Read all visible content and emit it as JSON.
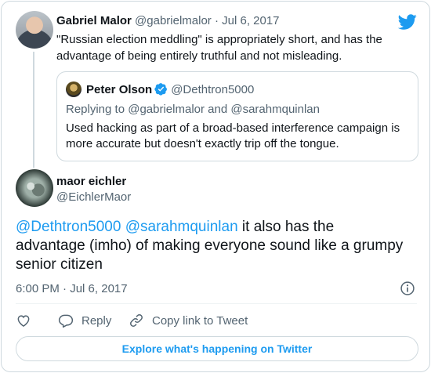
{
  "parent_tweet": {
    "name": "Gabriel Malor",
    "handle": "@gabrielmalor",
    "separator": " · ",
    "date": "Jul 6, 2017",
    "text": "\"Russian election meddling\" is appropriately short, and has the advantage of being entirely truthful and not misleading."
  },
  "quoted_tweet": {
    "name": "Peter Olson",
    "handle": "@Dethtron5000",
    "reply_prefix": "Replying to ",
    "reply_user_1": "@gabrielmalor",
    "reply_and": " and ",
    "reply_user_2": "@sarahmquinlan",
    "text": "Used hacking as part of a broad-based interference campaign is more accurate but doesn't exactly trip off the tongue."
  },
  "main_tweet": {
    "name": "maor eichler",
    "handle": "@EichlerMaor",
    "mention_1": "@Dethtron5000",
    "mention_2": "@sarahmquinlan",
    "text_rest": " it also has the advantage (imho) of making everyone sound like a grumpy senior citizen",
    "time": "6:00 PM",
    "date_sep": " · ",
    "date": "Jul 6, 2017"
  },
  "actions": {
    "reply_label": "Reply",
    "copy_link_label": "Copy link to Tweet"
  },
  "explore_label": "Explore what's happening on Twitter",
  "icons": {
    "brand": "twitter-bird-icon",
    "verified": "verified-badge-icon",
    "info": "info-icon",
    "like": "heart-icon",
    "reply": "reply-bubble-icon",
    "link": "link-icon"
  },
  "colors": {
    "accent": "#1d9bf0",
    "muted": "#536471",
    "border": "#cfd9de"
  }
}
